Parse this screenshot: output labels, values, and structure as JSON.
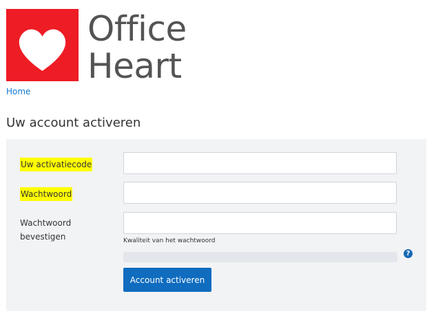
{
  "brand": {
    "line1": "Office",
    "line2": "Heart",
    "logo_color": "#ee1c25"
  },
  "breadcrumb": {
    "home": "Home"
  },
  "page": {
    "title": "Uw account activeren"
  },
  "form": {
    "activation_code_label": "Uw activatiecode",
    "activation_code_value": "",
    "password_label": "Wachtwoord",
    "password_value": "",
    "confirm_label_line1": "Wachtwoord",
    "confirm_label_line2": "bevestigen",
    "confirm_value": "",
    "quality_hint": "Kwaliteit van het wachtwoord",
    "strength_level": 0,
    "help_symbol": "?",
    "submit_label": "Account activeren",
    "highlight_color": "#ffff00",
    "button_color": "#0f6cbf"
  }
}
